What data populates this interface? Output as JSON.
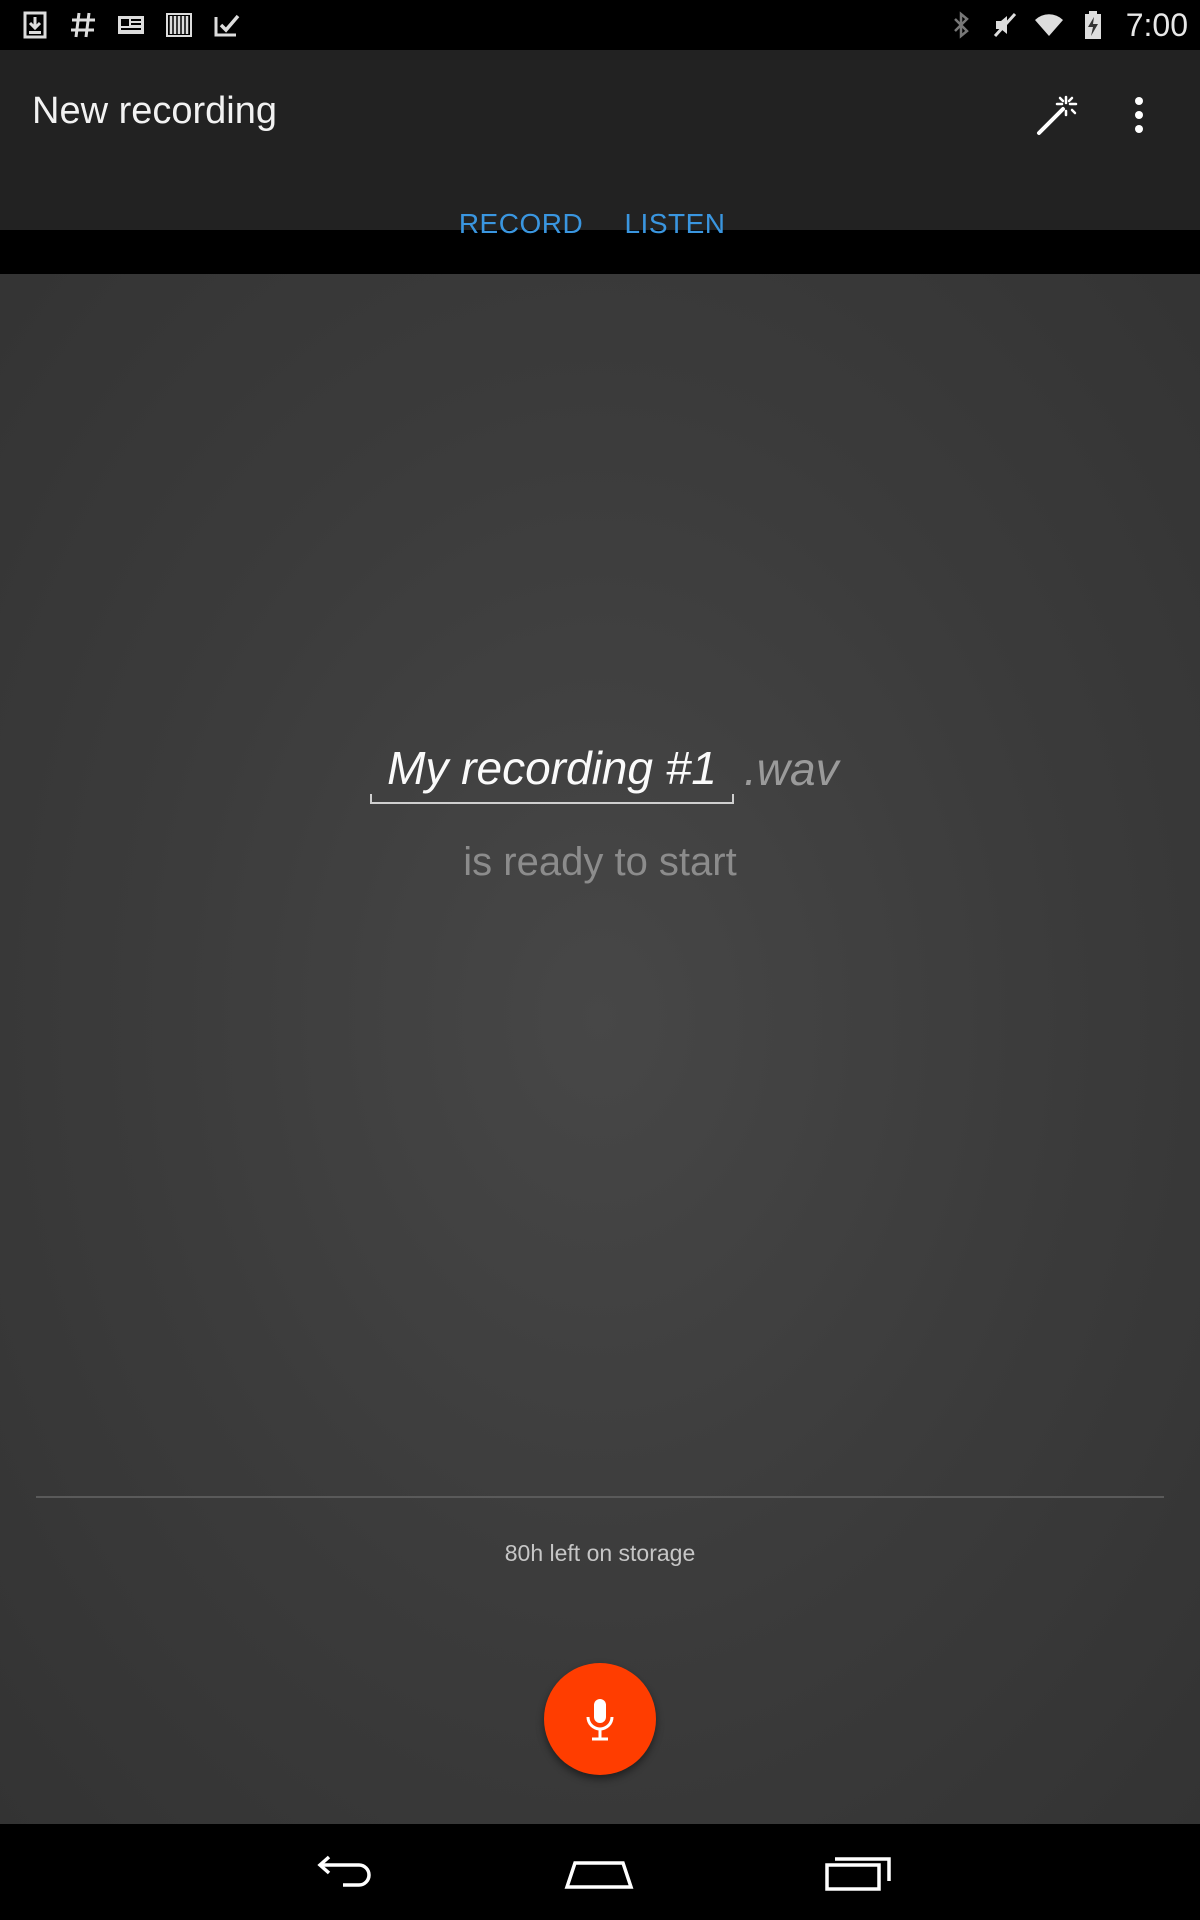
{
  "status_bar": {
    "left_icons": [
      "download-icon",
      "hashtag-icon",
      "news-icon",
      "barcode-icon",
      "check-icon"
    ],
    "right_icons": [
      "bluetooth-icon",
      "mute-icon",
      "wifi-icon",
      "battery-charging-icon"
    ],
    "time": "7:00"
  },
  "action_bar": {
    "title": "New recording",
    "actions": [
      "magic-wand-icon",
      "overflow-menu-icon"
    ]
  },
  "tabs": [
    {
      "label": "RECORD",
      "selected": true
    },
    {
      "label": "LISTEN",
      "selected": false
    }
  ],
  "recording": {
    "filename": "My recording #1",
    "extension": ".wav",
    "status": "is ready to start"
  },
  "storage": {
    "text": "80h left on storage"
  },
  "record_button": {
    "icon": "microphone-icon",
    "color": "#ff3d00"
  },
  "nav_bar": {
    "buttons": [
      "back-icon",
      "home-icon",
      "recents-icon"
    ]
  },
  "colors": {
    "accent": "#3a96e0",
    "record": "#ff3d00",
    "action_bar": "#222222"
  }
}
